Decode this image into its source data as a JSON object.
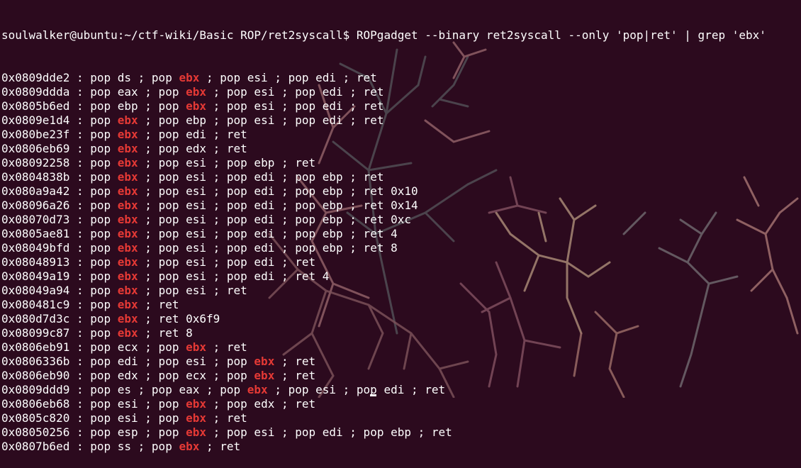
{
  "terminal": {
    "prompt": "soulwalker@ubuntu:~/ctf-wiki/Basic ROP/ret2syscall$ ",
    "command": "ROPgadget --binary ret2syscall --only 'pop|ret' | grep 'ebx'",
    "highlight": "ebx",
    "highlight_color": "#e53935",
    "text_color": "#ffffff",
    "background_color": "#2c0a1e",
    "output": [
      "0x0809dde2 : pop ds ; pop ebx ; pop esi ; pop edi ; ret",
      "0x0809ddda : pop eax ; pop ebx ; pop esi ; pop edi ; ret",
      "0x0805b6ed : pop ebp ; pop ebx ; pop esi ; pop edi ; ret",
      "0x0809e1d4 : pop ebx ; pop ebp ; pop esi ; pop edi ; ret",
      "0x080be23f : pop ebx ; pop edi ; ret",
      "0x0806eb69 : pop ebx ; pop edx ; ret",
      "0x08092258 : pop ebx ; pop esi ; pop ebp ; ret",
      "0x0804838b : pop ebx ; pop esi ; pop edi ; pop ebp ; ret",
      "0x080a9a42 : pop ebx ; pop esi ; pop edi ; pop ebp ; ret 0x10",
      "0x08096a26 : pop ebx ; pop esi ; pop edi ; pop ebp ; ret 0x14",
      "0x08070d73 : pop ebx ; pop esi ; pop edi ; pop ebp ; ret 0xc",
      "0x0805ae81 : pop ebx ; pop esi ; pop edi ; pop ebp ; ret 4",
      "0x08049bfd : pop ebx ; pop esi ; pop edi ; pop ebp ; ret 8",
      "0x08048913 : pop ebx ; pop esi ; pop edi ; ret",
      "0x08049a19 : pop ebx ; pop esi ; pop edi ; ret 4",
      "0x08049a94 : pop ebx ; pop esi ; ret",
      "0x080481c9 : pop ebx ; ret",
      "0x080d7d3c : pop ebx ; ret 0x6f9",
      "0x08099c87 : pop ebx ; ret 8",
      "0x0806eb91 : pop ecx ; pop ebx ; ret",
      "0x0806336b : pop edi ; pop esi ; pop ebx ; ret",
      "0x0806eb90 : pop edx ; pop ecx ; pop ebx ; ret",
      "0x0809ddd9 : pop es ; pop eax ; pop ebx ; pop esi ; pop edi ; ret",
      "0x0806eb68 : pop esi ; pop ebx ; pop edx ; ret",
      "0x0805c820 : pop esi ; pop ebx ; ret",
      "0x08050256 : pop esp ; pop ebx ; pop esi ; pop edi ; pop ebp ; ret",
      "0x0807b6ed : pop ss ; pop ebx ; ret"
    ]
  }
}
